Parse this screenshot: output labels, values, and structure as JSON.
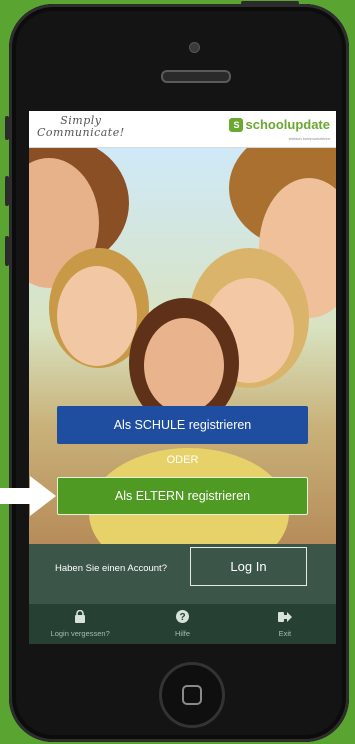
{
  "header": {
    "slogan_line1": "Simply",
    "slogan_line2": "Communicate!",
    "brand_name": "schoolupdate",
    "brand_tagline": "einfach kommunizieren"
  },
  "buttons": {
    "school": "Als SCHULE registrieren",
    "separator": "ODER",
    "parent": "Als ELTERN registrieren"
  },
  "account": {
    "question": "Haben Sie einen Account?",
    "login": "Log In"
  },
  "bottom_nav": [
    {
      "icon": "lock-icon",
      "glyph": "🔒",
      "label": "Login vergessen?"
    },
    {
      "icon": "help-icon",
      "glyph": "❓",
      "label": "Hilfe"
    },
    {
      "icon": "exit-icon",
      "glyph": "➜",
      "label": "Exit"
    }
  ],
  "colors": {
    "background": "#5aa531",
    "school_button": "#1f4ea1",
    "parent_button": "#4f9a22",
    "brand": "#6aa832"
  }
}
